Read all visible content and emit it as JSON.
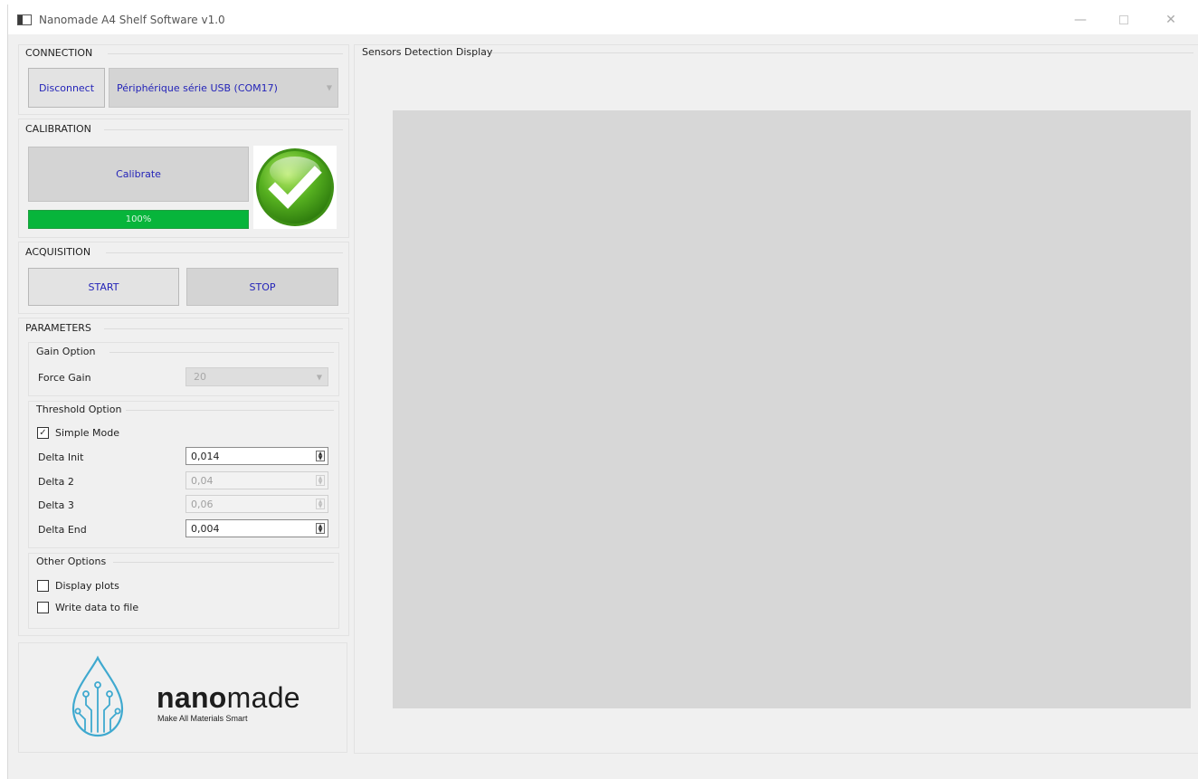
{
  "window": {
    "title": "Nanomade A4 Shelf Software v1.0",
    "controls": {
      "minimize": "—",
      "close": "✕"
    }
  },
  "connection": {
    "title": "CONNECTION",
    "disconnect_label": "Disconnect",
    "port_selected": "Périphérique série USB (COM17)"
  },
  "calibration": {
    "title": "CALIBRATION",
    "calibrate_label": "Calibrate",
    "progress_text": "100%",
    "progress_value": 100,
    "status_icon": "checkmark-success-icon"
  },
  "acquisition": {
    "title": "ACQUISITION",
    "start_label": "START",
    "stop_label": "STOP"
  },
  "parameters": {
    "title": "PARAMETERS",
    "gain_option": {
      "title": "Gain Option",
      "force_gain_label": "Force Gain",
      "force_gain_value": "20"
    },
    "threshold_option": {
      "title": "Threshold Option",
      "simple_mode_label": "Simple Mode",
      "simple_mode_checked": true,
      "check_mark": "✓",
      "delta_init_label": "Delta Init",
      "delta_init_value": "0,014",
      "delta_2_label": "Delta 2",
      "delta_2_value": "0,04",
      "delta_3_label": "Delta 3",
      "delta_3_value": "0,06",
      "delta_end_label": "Delta End",
      "delta_end_value": "0,004"
    },
    "other_options": {
      "title": "Other Options",
      "display_plots_label": "Display plots",
      "display_plots_checked": false,
      "write_data_label": "Write data to file",
      "write_data_checked": false
    }
  },
  "logo": {
    "word_bold": "nano",
    "word_light": "made",
    "tagline": "Make All Materials Smart"
  },
  "display": {
    "title": "Sensors Detection Display"
  },
  "colors": {
    "accent_text": "#2424b8",
    "progress_green": "#07b53b",
    "logo_blue": "#3fa9cf",
    "display_gray": "#d7d7d7"
  }
}
